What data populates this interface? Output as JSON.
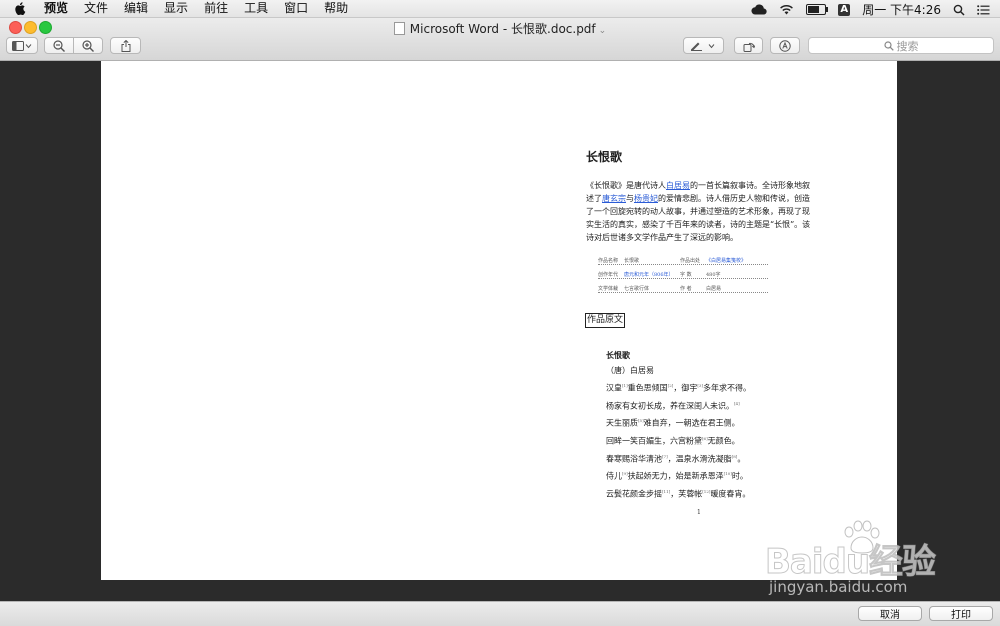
{
  "menubar": {
    "app": "预览",
    "menus": [
      "文件",
      "编辑",
      "显示",
      "前往",
      "工具",
      "窗口",
      "帮助"
    ],
    "input_method": "A",
    "clock": "周一 下午4:26",
    "battery_level": 0.8
  },
  "window": {
    "title": "Microsoft Word - 长恨歌.doc.pdf",
    "search_placeholder": "搜索"
  },
  "document": {
    "heading": "长恨歌",
    "intro": [
      {
        "t": "《长恨歌》是唐代诗人"
      },
      {
        "t": "白居易",
        "link": true
      },
      {
        "t": "的一首长篇叙事诗。全诗形象地叙述了"
      },
      {
        "t": "唐玄宗",
        "link": true
      },
      {
        "t": "与"
      },
      {
        "t": "杨贵妃",
        "link": true
      },
      {
        "t": "的爱情悲剧。诗人借历史人物和传说，创造了一个回旋宛转的动人故事，并通过塑造的艺术形象，再现了现实生活的真实，感染了千百年来的读者，诗的主题是“长恨”。该诗对后世诸多文学作品产生了深远的影响。"
      }
    ],
    "info_rows": [
      [
        {
          "k": "作品名称",
          "v": "长恨歌"
        },
        {
          "k": "作品出处",
          "v": "《白居易集笺校》",
          "link": true
        }
      ],
      [
        {
          "k": "创作年代",
          "v": "唐元和元年（806年）",
          "link": true
        },
        {
          "k": "字    数",
          "v": "480字"
        }
      ],
      [
        {
          "k": "文学体裁",
          "v": "七言歌行体"
        },
        {
          "k": "作    者",
          "v": "白居易"
        }
      ]
    ],
    "section_title": "作品原文",
    "poem": {
      "title": "长恨歌",
      "author": "（唐）白居易",
      "lines": [
        [
          {
            "t": "汉皇"
          },
          {
            "s": "[1]"
          },
          {
            "t": "重色思倾国"
          },
          {
            "s": "[2]"
          },
          {
            "t": "，御宇"
          },
          {
            "s": "[3]"
          },
          {
            "t": "多年求不得。"
          }
        ],
        [
          {
            "t": "杨家有女初长成，养在深闺人未识。"
          },
          {
            "s": "[4]"
          }
        ],
        [
          {
            "t": "天生丽质"
          },
          {
            "s": "[5]"
          },
          {
            "t": "难自弃，一朝选在君王侧。"
          }
        ],
        [
          {
            "t": "回眸一笑百媚生，六宫粉黛"
          },
          {
            "s": "[6]"
          },
          {
            "t": "无颜色。"
          }
        ],
        [
          {
            "t": "春寒赐浴华清池"
          },
          {
            "s": "[7]"
          },
          {
            "t": "，温泉水滑洗凝脂"
          },
          {
            "s": "[8]"
          },
          {
            "t": "。"
          }
        ],
        [
          {
            "t": "侍儿"
          },
          {
            "s": "[9]"
          },
          {
            "t": "扶起娇无力，始是新承恩泽"
          },
          {
            "s": "[10]"
          },
          {
            "t": "时。"
          }
        ],
        [
          {
            "t": "云鬓花颜金步摇"
          },
          {
            "s": "[11]"
          },
          {
            "t": "，芙蓉帐"
          },
          {
            "s": "[12]"
          },
          {
            "t": "暖度春宵。"
          }
        ]
      ]
    },
    "page_number": "1"
  },
  "dialog": {
    "cancel_label": "取消",
    "print_label": "打印"
  },
  "watermark": {
    "logo_text": "Baidu经验",
    "url": "jingyan.baidu.com"
  },
  "colors": {
    "link": "#2a5bd6",
    "close": "#fc5f57",
    "minimize": "#fdbc2e",
    "maximize": "#28c840"
  }
}
